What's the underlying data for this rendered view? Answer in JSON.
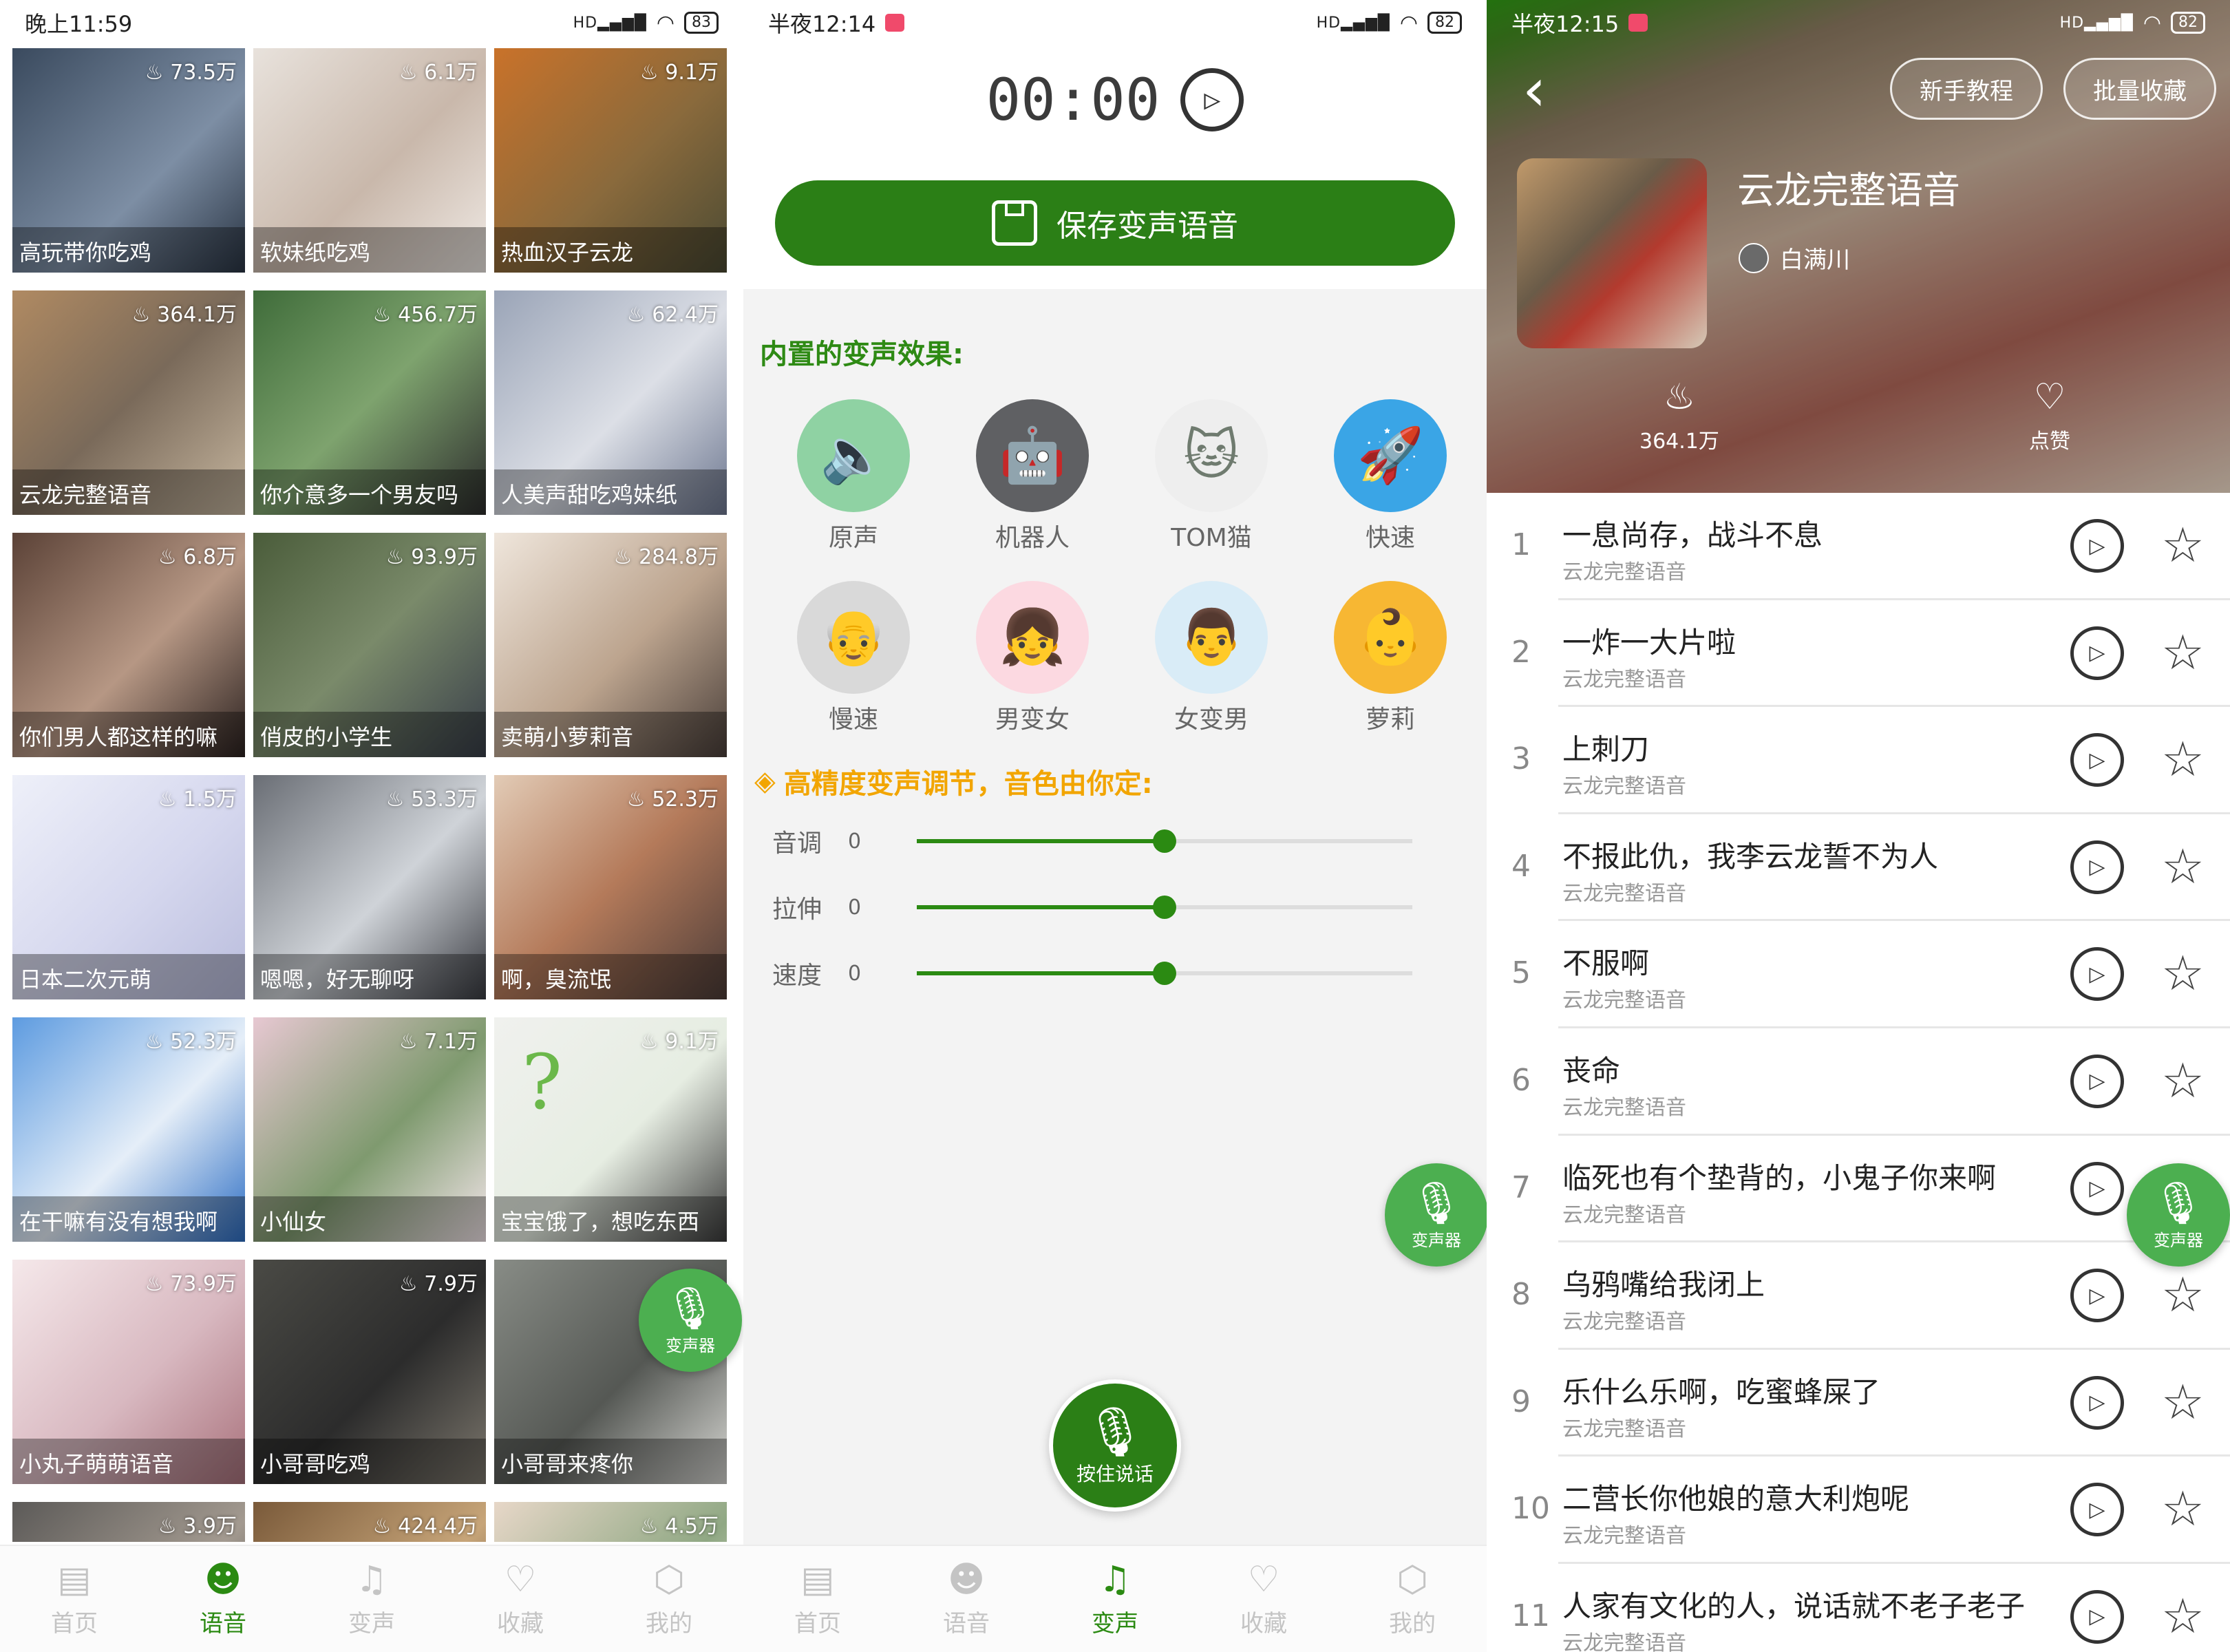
{
  "screen1": {
    "status": {
      "time": "晚上11:59",
      "signal": "HD",
      "battery": "83"
    },
    "cards": [
      {
        "count": "73.5万",
        "title": "高玩带你吃鸡"
      },
      {
        "count": "6.1万",
        "title": "软妹纸吃鸡"
      },
      {
        "count": "9.1万",
        "title": "热血汉子云龙"
      },
      {
        "count": "364.1万",
        "title": "云龙完整语音"
      },
      {
        "count": "456.7万",
        "title": "你介意多一个男友吗"
      },
      {
        "count": "62.4万",
        "title": "人美声甜吃鸡妹纸"
      },
      {
        "count": "6.8万",
        "title": "你们男人都这样的嘛"
      },
      {
        "count": "93.9万",
        "title": "俏皮的小学生"
      },
      {
        "count": "284.8万",
        "title": "卖萌小萝莉音"
      },
      {
        "count": "1.5万",
        "title": "日本二次元萌"
      },
      {
        "count": "53.3万",
        "title": "嗯嗯，好无聊呀"
      },
      {
        "count": "52.3万",
        "title": "啊，臭流氓"
      },
      {
        "count": "52.3万",
        "title": "在干嘛有没有想我啊"
      },
      {
        "count": "7.1万",
        "title": "小仙女"
      },
      {
        "count": "9.1万",
        "title": "宝宝饿了，想吃东西"
      },
      {
        "count": "73.9万",
        "title": "小丸子萌萌语音"
      },
      {
        "count": "7.9万",
        "title": "小哥哥吃鸡"
      },
      {
        "count": "",
        "title": "小哥哥来疼你"
      },
      {
        "count": "3.9万",
        "title": ""
      },
      {
        "count": "424.4万",
        "title": ""
      },
      {
        "count": "4.5万",
        "title": ""
      }
    ],
    "fab_label": "变声器",
    "nav": [
      {
        "label": "首页",
        "icon": "home-icon"
      },
      {
        "label": "语音",
        "icon": "voice-icon"
      },
      {
        "label": "变声",
        "icon": "voice-change-icon"
      },
      {
        "label": "收藏",
        "icon": "heart-icon"
      },
      {
        "label": "我的",
        "icon": "profile-icon"
      }
    ],
    "active_nav": "语音"
  },
  "screen2": {
    "status": {
      "time": "半夜12:14",
      "signal": "HD",
      "battery": "82"
    },
    "timer": "00:00",
    "save_label": "保存变声语音",
    "effects_title": "内置的变声效果:",
    "effects": [
      {
        "label": "原声",
        "icon": "speaker-icon"
      },
      {
        "label": "机器人",
        "icon": "robot-icon"
      },
      {
        "label": "TOM猫",
        "icon": "cat-icon"
      },
      {
        "label": "快速",
        "icon": "rocket-icon"
      },
      {
        "label": "慢速",
        "icon": "old-man-icon"
      },
      {
        "label": "男变女",
        "icon": "girl-icon"
      },
      {
        "label": "女变男",
        "icon": "man-icon"
      },
      {
        "label": "萝莉",
        "icon": "loli-icon"
      }
    ],
    "precision_title": "高精度变声调节，音色由你定:",
    "sliders": [
      {
        "label": "音调",
        "value": "0",
        "level": 0.5
      },
      {
        "label": "拉伸",
        "value": "0",
        "level": 0.5
      },
      {
        "label": "速度",
        "value": "0",
        "level": 0.5
      }
    ],
    "fab_label": "变声器",
    "talk_label": "按住说话",
    "active_nav": "变声"
  },
  "screen3": {
    "status": {
      "time": "半夜12:15",
      "signal": "HD",
      "battery": "82"
    },
    "tutorial_label": "新手教程",
    "batch_label": "批量收藏",
    "album_title": "云龙完整语音",
    "author": "白满川",
    "plays": "364.1万",
    "like_label": "点赞",
    "fab_label": "变声器",
    "tracks": [
      {
        "num": "1",
        "title": "一息尚存，战斗不息",
        "sub": "云龙完整语音"
      },
      {
        "num": "2",
        "title": "一炸一大片啦",
        "sub": "云龙完整语音"
      },
      {
        "num": "3",
        "title": "上刺刀",
        "sub": "云龙完整语音"
      },
      {
        "num": "4",
        "title": "不报此仇，我李云龙誓不为人",
        "sub": "云龙完整语音"
      },
      {
        "num": "5",
        "title": "不服啊",
        "sub": "云龙完整语音"
      },
      {
        "num": "6",
        "title": "丧命",
        "sub": "云龙完整语音"
      },
      {
        "num": "7",
        "title": "临死也有个垫背的，小鬼子你来啊",
        "sub": "云龙完整语音"
      },
      {
        "num": "8",
        "title": "乌鸦嘴给我闭上",
        "sub": "云龙完整语音"
      },
      {
        "num": "9",
        "title": "乐什么乐啊，吃蜜蜂屎了",
        "sub": "云龙完整语音"
      },
      {
        "num": "10",
        "title": "二营长你他娘的意大利炮呢",
        "sub": "云龙完整语音"
      },
      {
        "num": "11",
        "title": "人家有文化的人，说话就不老子老子",
        "sub": "云龙完整语音"
      }
    ]
  }
}
